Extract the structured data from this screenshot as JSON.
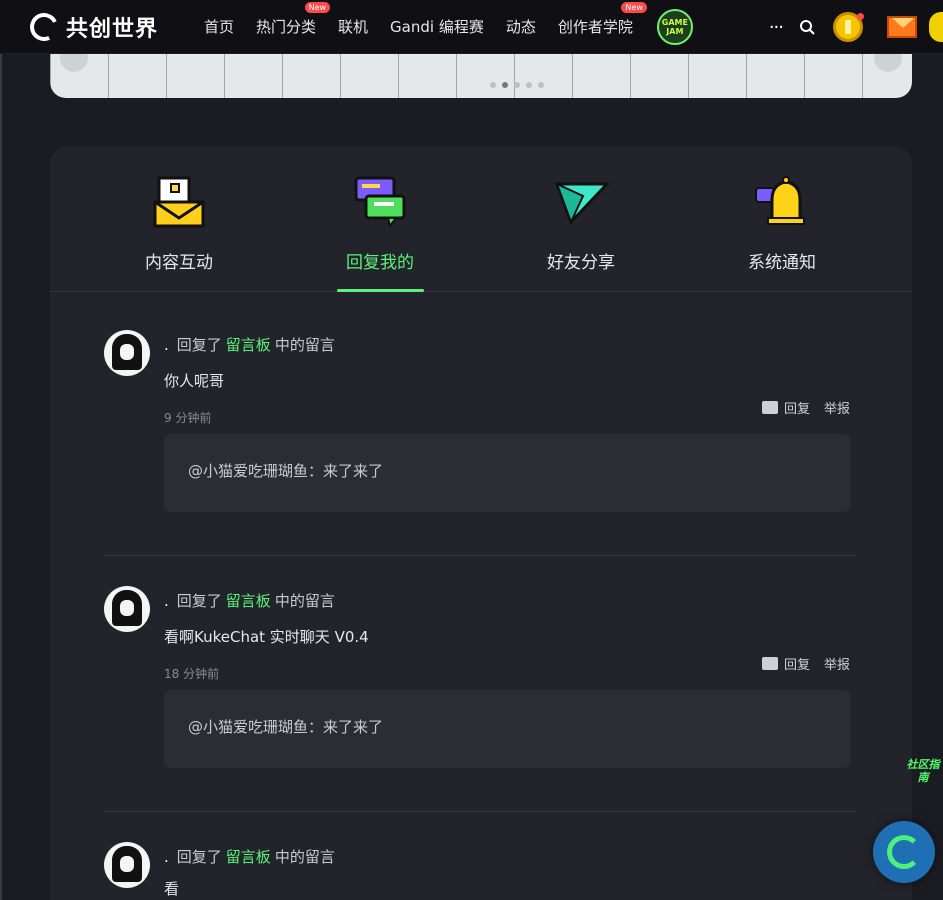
{
  "header": {
    "logo_text": "共创世界",
    "nav": [
      {
        "label": "首页",
        "badge": ""
      },
      {
        "label": "热门分类",
        "badge": "New"
      },
      {
        "label": "联机",
        "badge": ""
      },
      {
        "label": "Gandi 编程赛",
        "badge": ""
      },
      {
        "label": "动态",
        "badge": ""
      },
      {
        "label": "创作者学院",
        "badge": "New"
      }
    ],
    "gamejam_label": "GAME JAM",
    "more_label": "···"
  },
  "tabs": [
    {
      "label": "内容互动",
      "icon": "envelope-icon",
      "active": false
    },
    {
      "label": "回复我的",
      "icon": "chat-bubbles-icon",
      "active": true
    },
    {
      "label": "好友分享",
      "icon": "paper-plane-icon",
      "active": false
    },
    {
      "label": "系统通知",
      "icon": "bell-icon",
      "active": false
    }
  ],
  "messages": [
    {
      "username": ".",
      "action_prefix": "回复了",
      "target": "留言板",
      "action_suffix": "中的留言",
      "content": "你人呢哥",
      "time": "9 分钟前",
      "reply_label": "回复",
      "report_label": "举报",
      "quote": "@小猫爱吃珊瑚鱼：来了来了"
    },
    {
      "username": ".",
      "action_prefix": "回复了",
      "target": "留言板",
      "action_suffix": "中的留言",
      "content": "看啊KukeChat 实时聊天 V0.4",
      "time": "18 分钟前",
      "reply_label": "回复",
      "report_label": "举报",
      "quote": "@小猫爱吃珊瑚鱼：来了来了"
    },
    {
      "username": ".",
      "action_prefix": "回复了",
      "target": "留言板",
      "action_suffix": "中的留言",
      "content": "看"
    }
  ],
  "floating": {
    "guide_label": "社区指南"
  },
  "colors": {
    "accent": "#5af27a",
    "background": "#1b1b22",
    "panel": "#23232b"
  }
}
